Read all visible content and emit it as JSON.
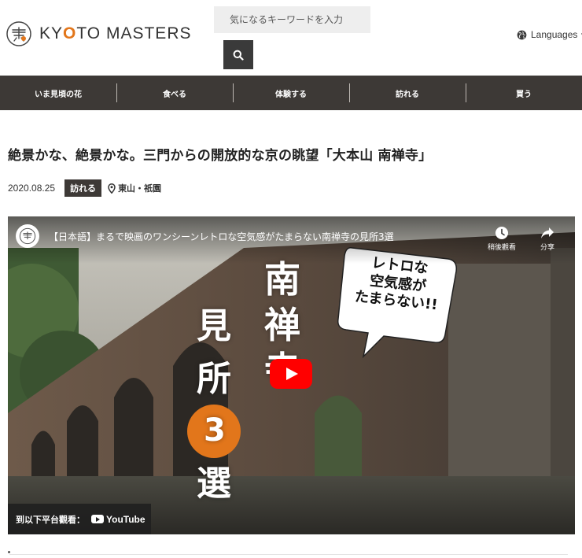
{
  "site": {
    "logo_text_prefix": "KY",
    "logo_text_o": "O",
    "logo_text_suffix": "TO MASTERS"
  },
  "search": {
    "placeholder": "気になるキーワードを入力"
  },
  "language": {
    "label": "Languages"
  },
  "nav": {
    "items": [
      {
        "label": "いま見頃の花"
      },
      {
        "label": "食べる"
      },
      {
        "label": "体験する"
      },
      {
        "label": "訪れる"
      },
      {
        "label": "買う"
      }
    ]
  },
  "article": {
    "title": "絶景かな、絶景かな。三門からの開放的な京の眺望「大本山 南禅寺」",
    "date": "2020.08.25",
    "category": "訪れる",
    "location": "東山・祇園"
  },
  "video": {
    "title": "【日本語】まるで映画のワンシーンレトロな空気感がたまらない南禅寺の見所3選",
    "watch_later": "稍後觀看",
    "share": "分享",
    "thumb_text_right": "南禅寺",
    "thumb_text_left_1": "見",
    "thumb_text_left_2": "所",
    "thumb_text_left_num": "3",
    "thumb_text_left_3": "選",
    "bubble_line1": "レトロな",
    "bubble_line2": "空気感が",
    "bubble_line3": "たまらない!!",
    "watch_on": "到以下平台觀看：",
    "youtube": "YouTube"
  },
  "colors": {
    "nav_bg": "#3d3936",
    "accent_orange": "#e2761b",
    "play_red": "#ff0000"
  }
}
